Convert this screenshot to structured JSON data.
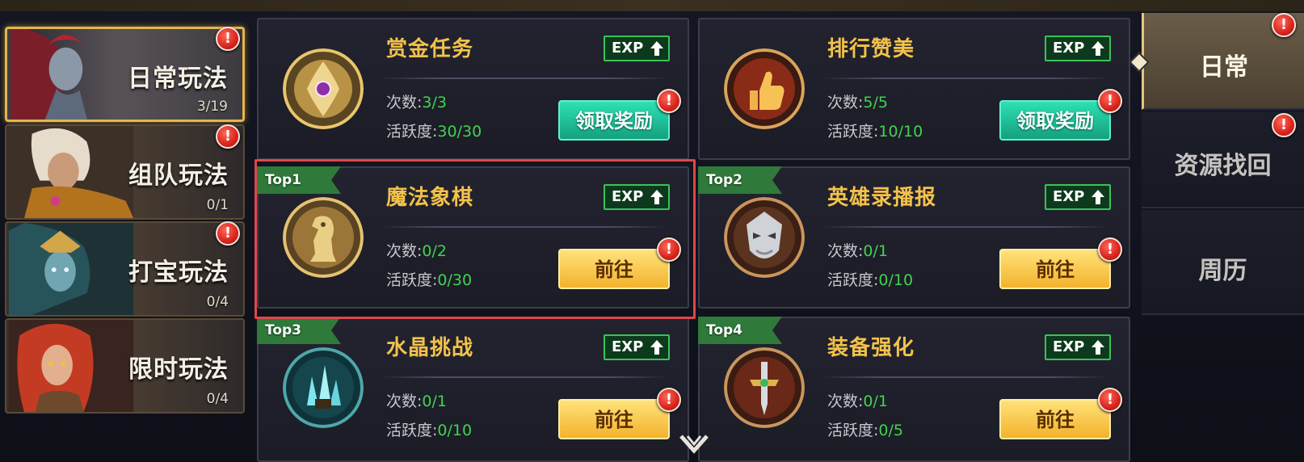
{
  "categories": [
    {
      "label": "日常玩法",
      "count": "3/19",
      "active": true,
      "alert": "!"
    },
    {
      "label": "组队玩法",
      "count": "0/1",
      "active": false,
      "alert": "!"
    },
    {
      "label": "打宝玩法",
      "count": "0/4",
      "active": false,
      "alert": "!"
    },
    {
      "label": "限时玩法",
      "count": "0/4",
      "active": false,
      "alert": "!"
    }
  ],
  "tasks": [
    {
      "title": "赏金任务",
      "icon": "bounty-emblem-icon",
      "exp": "EXP",
      "times_label": "次数:",
      "times": "3/3",
      "activity_label": "活跃度:",
      "activity": "30/30",
      "button": "领取奖励",
      "button_type": "claim",
      "alert": "!"
    },
    {
      "title": "排行赞美",
      "icon": "thumbs-up-icon",
      "exp": "EXP",
      "times_label": "次数:",
      "times": "5/5",
      "activity_label": "活跃度:",
      "activity": "10/10",
      "button": "领取奖励",
      "button_type": "claim",
      "alert": "!"
    },
    {
      "title": "魔法象棋",
      "icon": "chess-knight-icon",
      "rank": "Top1",
      "exp": "EXP",
      "times_label": "次数:",
      "times": "0/2",
      "activity_label": "活跃度:",
      "activity": "0/30",
      "button": "前往",
      "button_type": "go",
      "alert": "!"
    },
    {
      "title": "英雄录播报",
      "icon": "hero-mask-icon",
      "rank": "Top2",
      "exp": "EXP",
      "times_label": "次数:",
      "times": "0/1",
      "activity_label": "活跃度:",
      "activity": "0/10",
      "button": "前往",
      "button_type": "go",
      "alert": "!"
    },
    {
      "title": "水晶挑战",
      "icon": "crystal-cluster-icon",
      "rank": "Top3",
      "exp": "EXP",
      "times_label": "次数:",
      "times": "0/1",
      "activity_label": "活跃度:",
      "activity": "0/10",
      "button": "前往",
      "button_type": "go",
      "alert": "!"
    },
    {
      "title": "装备强化",
      "icon": "sword-emblem-icon",
      "rank": "Top4",
      "exp": "EXP",
      "times_label": "次数:",
      "times": "0/1",
      "activity_label": "活跃度:",
      "activity": "0/5",
      "button": "前往",
      "button_type": "go",
      "alert": "!"
    }
  ],
  "tabs": [
    {
      "label": "日常",
      "active": true,
      "alert": "!"
    },
    {
      "label": "资源找回",
      "active": false,
      "alert": "!"
    },
    {
      "label": "周历",
      "active": false
    }
  ],
  "colors": {
    "accent_gold": "#f3c24a",
    "value_green": "#41d34f",
    "claim_teal": "#1fc79c",
    "go_yellow": "#f6c140",
    "alert_red": "#d8231c",
    "highlight_red": "#e0464b"
  }
}
